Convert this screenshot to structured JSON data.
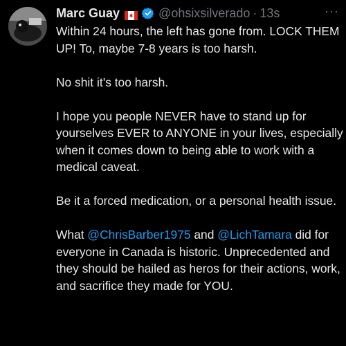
{
  "tweet": {
    "author_name": "Marc Guay",
    "flag_icon": "canada-flag-icon",
    "verified_icon": "verified-badge-icon",
    "verified_color": "#1d9bf0",
    "handle": "@ohsixsilverado",
    "separator": "·",
    "time": "13s",
    "more_icon": "more-options-icon",
    "paragraphs": {
      "p1": "Within 24 hours, the left has gone from. LOCK THEM UP! To, maybe 7-8 years is too harsh.",
      "p2": "No shit it’s too harsh.",
      "p3": "I hope you people NEVER have to stand up for yourselves EVER to ANYONE in your lives, especially when it comes down to being able to work with a medical caveat.",
      "p4": "Be it a forced medication, or a personal health issue.",
      "p5": {
        "part1": "What ",
        "mention1": "@ChrisBarber1975",
        "part2": " and ",
        "mention2": "@LichTamara",
        "part3": " did for everyone in Canada is historic. Unprecedented and they should be hailed as heros for their actions, work, and sacrifice they made for YOU."
      }
    }
  },
  "colors": {
    "background": "#000000",
    "text": "#e7e9ea",
    "secondary_text": "#71767b",
    "link": "#1d9bf0"
  }
}
